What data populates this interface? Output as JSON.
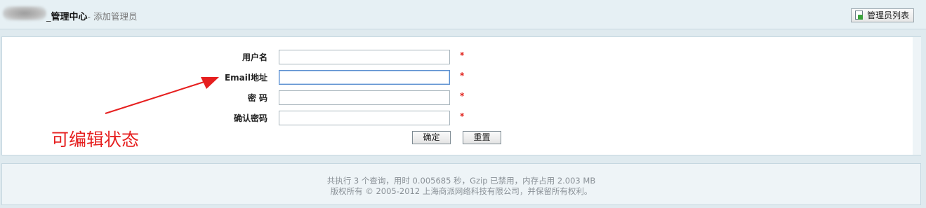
{
  "header": {
    "separator": "_",
    "title_main": "管理中心",
    "title_sub": "- 添加管理员",
    "list_button_label": "管理员列表",
    "list_button_icon": "add-document-icon"
  },
  "form": {
    "username_label": "用户名",
    "email_label": "Email地址",
    "password_label": "密 码",
    "confirm_label": "确认密码",
    "required_mark": "*",
    "username_value": "",
    "email_value": "",
    "password_value": "",
    "confirm_value": "",
    "submit_label": "确定",
    "reset_label": "重置"
  },
  "annotation": {
    "text": "可编辑状态",
    "color": "#e61f1f"
  },
  "footer": {
    "line1": "共执行 3 个查询，用时 0.005685 秒，Gzip 已禁用，内存占用 2.003 MB",
    "line2": "版权所有 © 2005-2012 上海商派网络科技有限公司，并保留所有权利。"
  }
}
